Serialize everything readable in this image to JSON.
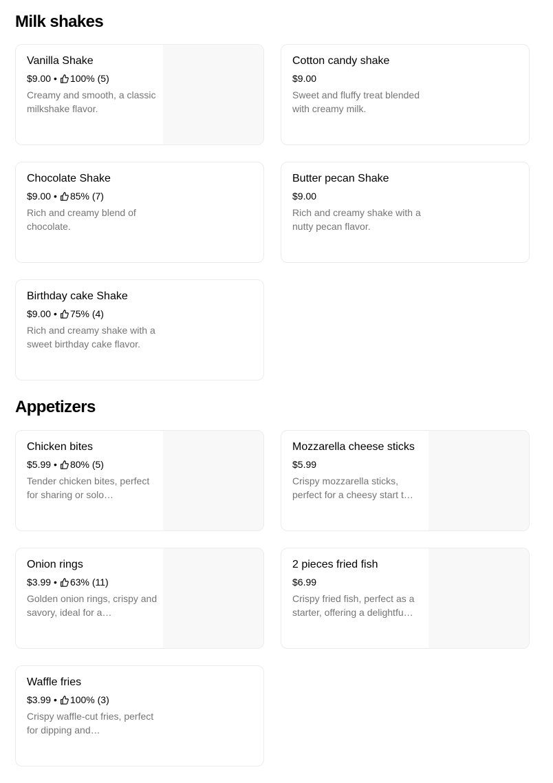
{
  "sections": [
    {
      "title": "Milk shakes",
      "items": [
        {
          "name": "Vanilla  Shake",
          "price": "$9.00",
          "rating": "100% (5)",
          "description": "Creamy and smooth, a classic milkshake flavor."
        },
        {
          "name": "Cotton candy shake",
          "price": "$9.00",
          "rating": "",
          "description": "Sweet and fluffy treat blended with creamy milk."
        },
        {
          "name": "Chocolate Shake",
          "price": "$9.00",
          "rating": "85% (7)",
          "description": "Rich and creamy blend of chocolate."
        },
        {
          "name": "Butter pecan Shake",
          "price": "$9.00",
          "rating": "",
          "description": "Rich and creamy shake with a nutty pecan flavor."
        },
        {
          "name": "Birthday cake Shake",
          "price": "$9.00",
          "rating": "75% (4)",
          "description": "Rich and creamy shake with a sweet birthday cake flavor."
        }
      ]
    },
    {
      "title": "Appetizers",
      "items": [
        {
          "name": "Chicken bites",
          "price": "$5.99",
          "rating": "80% (5)",
          "description": "Tender chicken bites, perfect for sharing or solo…"
        },
        {
          "name": "Mozzarella cheese sticks",
          "price": "$5.99",
          "rating": "",
          "description": "Crispy mozzarella sticks, perfect for a cheesy start t…"
        },
        {
          "name": "Onion rings",
          "price": "$3.99",
          "rating": "63% (11)",
          "description": "Golden onion rings, crispy and savory, ideal for a…"
        },
        {
          "name": "2 pieces fried fish",
          "price": "$6.99",
          "rating": "",
          "description": "Crispy fried fish, perfect as a starter, offering a delightfu…"
        },
        {
          "name": "Waffle fries",
          "price": "$3.99",
          "rating": "100% (3)",
          "description": "Crispy waffle-cut fries, perfect for dipping and…"
        }
      ]
    }
  ],
  "separator": "•",
  "icons": {
    "rating": "thumbs-up-icon"
  },
  "colors": {
    "text": "#000000",
    "muted": "#757575",
    "border": "#ececec",
    "image_placeholder": "#f8f8f8"
  }
}
